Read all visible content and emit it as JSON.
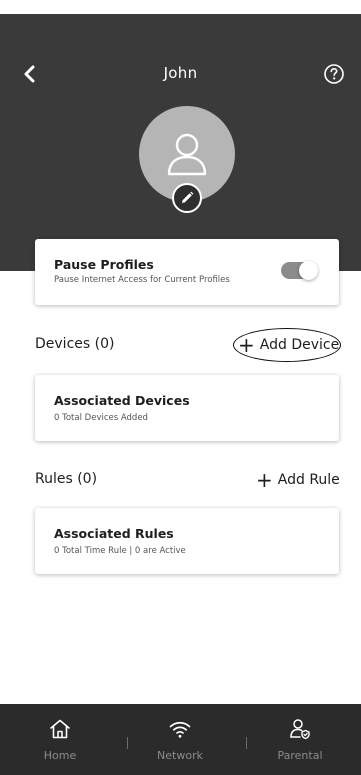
{
  "header": {
    "title": "John",
    "back_icon": "chevron-left-icon",
    "help_icon": "question-circle-icon",
    "avatar_icon": "user-outline-icon",
    "avatar_edit_icon": "pencil-icon",
    "background_color": "#3a3a3a"
  },
  "pause_profiles": {
    "title": "Pause Profiles",
    "subtitle": "Pause Internet Access for Current Profiles",
    "toggle_on": true
  },
  "devices": {
    "section_label": "Devices (0)",
    "add_label": "Add Device",
    "card_title": "Associated Devices",
    "card_subtitle": "0 Total Devices Added"
  },
  "rules": {
    "section_label": "Rules (0)",
    "add_label": "Add Rule",
    "card_title": "Associated Rules",
    "card_subtitle": "0 Total Time Rule | 0 are Active"
  },
  "bottom_nav": {
    "items": [
      {
        "label": "Home",
        "icon": "home-icon"
      },
      {
        "label": "Network",
        "icon": "wifi-icon"
      },
      {
        "label": "Parental",
        "icon": "parental-icon"
      }
    ],
    "background_color": "#2b2b2b"
  }
}
